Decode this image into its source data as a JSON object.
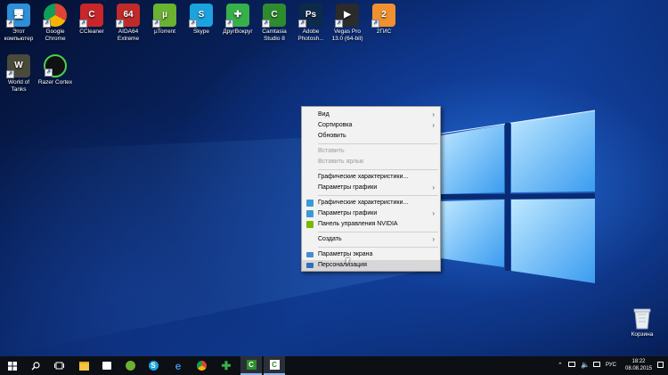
{
  "desktop_icons": [
    {
      "label_line1": "Этот",
      "label_line2": "компьютер",
      "icon": "computer-icon",
      "color": "#2d8fd8"
    },
    {
      "label_line1": "Google",
      "label_line2": "Chrome",
      "icon": "chrome-icon",
      "color": "#e8e8e8"
    },
    {
      "label_line1": "CCleaner",
      "label_line2": "",
      "icon": "ccleaner-icon",
      "color": "#c8262b"
    },
    {
      "label_line1": "AIDA64",
      "label_line2": "Extreme",
      "icon": "aida64-icon",
      "color": "#c22a2a"
    },
    {
      "label_line1": "µTorrent",
      "label_line2": "",
      "icon": "utorrent-icon",
      "color": "#6ab22f"
    },
    {
      "label_line1": "Skype",
      "label_line2": "",
      "icon": "skype-icon",
      "color": "#1ba3e0"
    },
    {
      "label_line1": "ДругВокруг",
      "label_line2": "",
      "icon": "drugvokrug-icon",
      "color": "#36b04a"
    },
    {
      "label_line1": "Camtasia",
      "label_line2": "Studio 8",
      "icon": "camtasia-icon",
      "color": "#2e8b2e"
    },
    {
      "label_line1": "Adobe",
      "label_line2": "Photosh...",
      "icon": "photoshop-icon",
      "color": "#0e2a4a"
    },
    {
      "label_line1": "Vegas Pro",
      "label_line2": "13.0 (64-bit)",
      "icon": "vegas-icon",
      "color": "#2b2b2b"
    },
    {
      "label_line1": "2ГИС",
      "label_line2": "",
      "icon": "2gis-icon",
      "color": "#f09030"
    },
    {
      "label_line1": "World of",
      "label_line2": "Tanks",
      "icon": "wot-icon",
      "color": "#4a4a3a"
    },
    {
      "label_line1": "Razer Cortex",
      "label_line2": "",
      "icon": "razer-icon",
      "color": "#111"
    }
  ],
  "icon_glyphs": [
    "🖥",
    "◉",
    "C",
    "64",
    "µ",
    "S",
    "✚",
    "C",
    "Ps",
    "▶",
    "2"
  ],
  "context_menu": {
    "items": [
      {
        "label": "Вид",
        "submenu": true
      },
      {
        "label": "Сортировка",
        "submenu": true
      },
      {
        "label": "Обновить"
      },
      {
        "label": "Вставить",
        "disabled": true
      },
      {
        "label": "Вставить ярлык",
        "disabled": true
      },
      {
        "label": "Графические характеристики..."
      },
      {
        "label": "Параметры графики",
        "submenu": true
      },
      {
        "label": "Графические характеристики...",
        "icon": "intel-graphics-icon"
      },
      {
        "label": "Параметры графики",
        "submenu": true,
        "icon": "intel-graphics-icon"
      },
      {
        "label": "Панель управления NVIDIA",
        "icon": "nvidia-icon"
      },
      {
        "label": "Создать",
        "submenu": true
      },
      {
        "label": "Параметры экрана",
        "icon": "display-icon"
      },
      {
        "label": "Персонализация",
        "icon": "personalize-icon",
        "highlighted": true
      }
    ]
  },
  "recycle_bin": {
    "label": "Корзина"
  },
  "taskbar": {
    "tray_language": "РУС",
    "time": "18:22",
    "date": "08.08.2015"
  },
  "colors": {
    "accent": "#8ab4e8",
    "menu_bg": "#f2f2f2",
    "taskbar": "#0c0f14"
  }
}
